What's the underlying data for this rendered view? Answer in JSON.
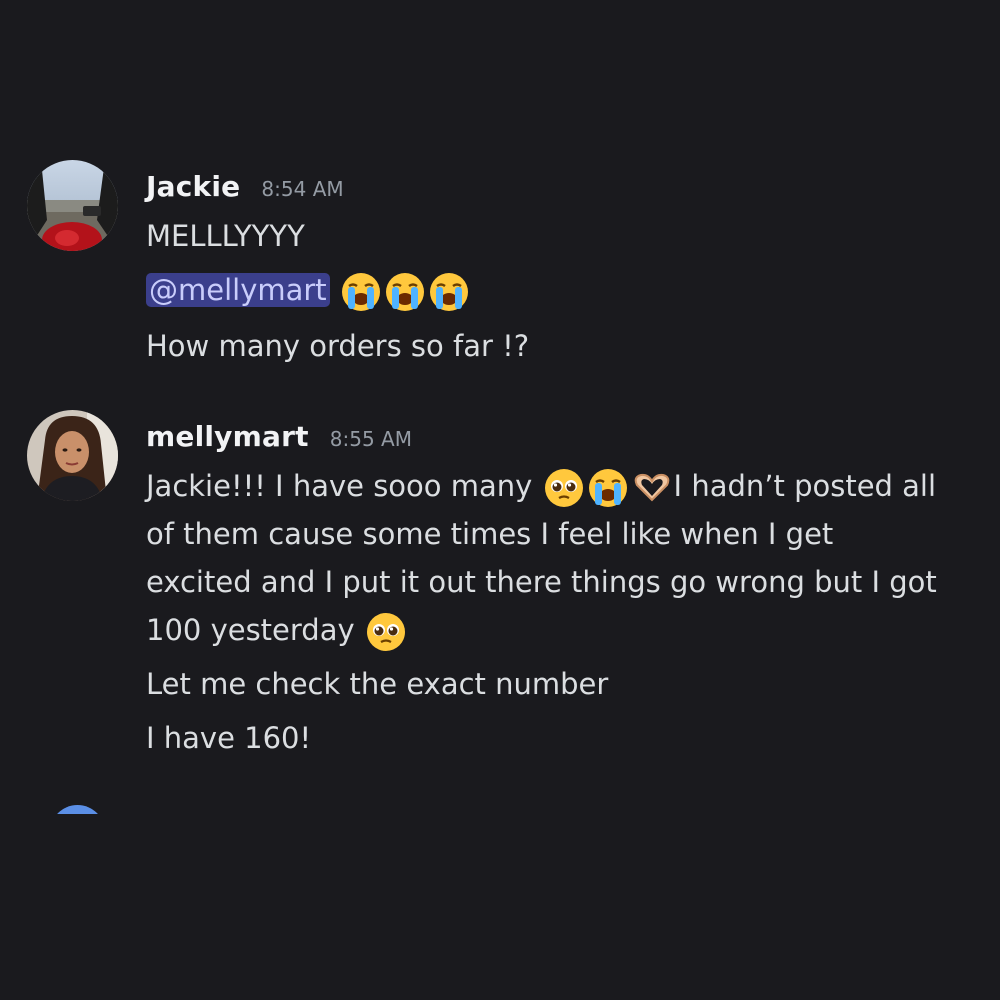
{
  "messages": [
    {
      "username": "Jackie",
      "timestamp": "8:54 AM",
      "lines": {
        "line1": "MELLLYYYY",
        "mention": "@mellymart",
        "line3": "How many orders so far !?"
      },
      "emojis": [
        "loudly-crying-face",
        "loudly-crying-face",
        "loudly-crying-face"
      ]
    },
    {
      "username": "mellymart",
      "timestamp": "8:55 AM",
      "lines": {
        "line1_a": "Jackie!!! I have sooo many ",
        "line1_b": "I hadn’t posted all",
        "line2": "of them cause some times I feel like when I get",
        "line3": "excited and I put it out there things go wrong but I got",
        "line4": "100 yesterday ",
        "line5": "Let me check the exact number",
        "line6": "I have 160!"
      },
      "emojis": [
        "pleading-face",
        "loudly-crying-face",
        "heart-hands",
        "pleading-face"
      ]
    }
  ],
  "colors": {
    "background": "#1a1a1e",
    "mention_bg": "#3b3f8c",
    "mention_text": "#c9cdfb",
    "username": "#f2f3f5",
    "timestamp": "#949ba4",
    "body_text": "#dbdee1",
    "next_avatar": "#5b8fe6"
  }
}
